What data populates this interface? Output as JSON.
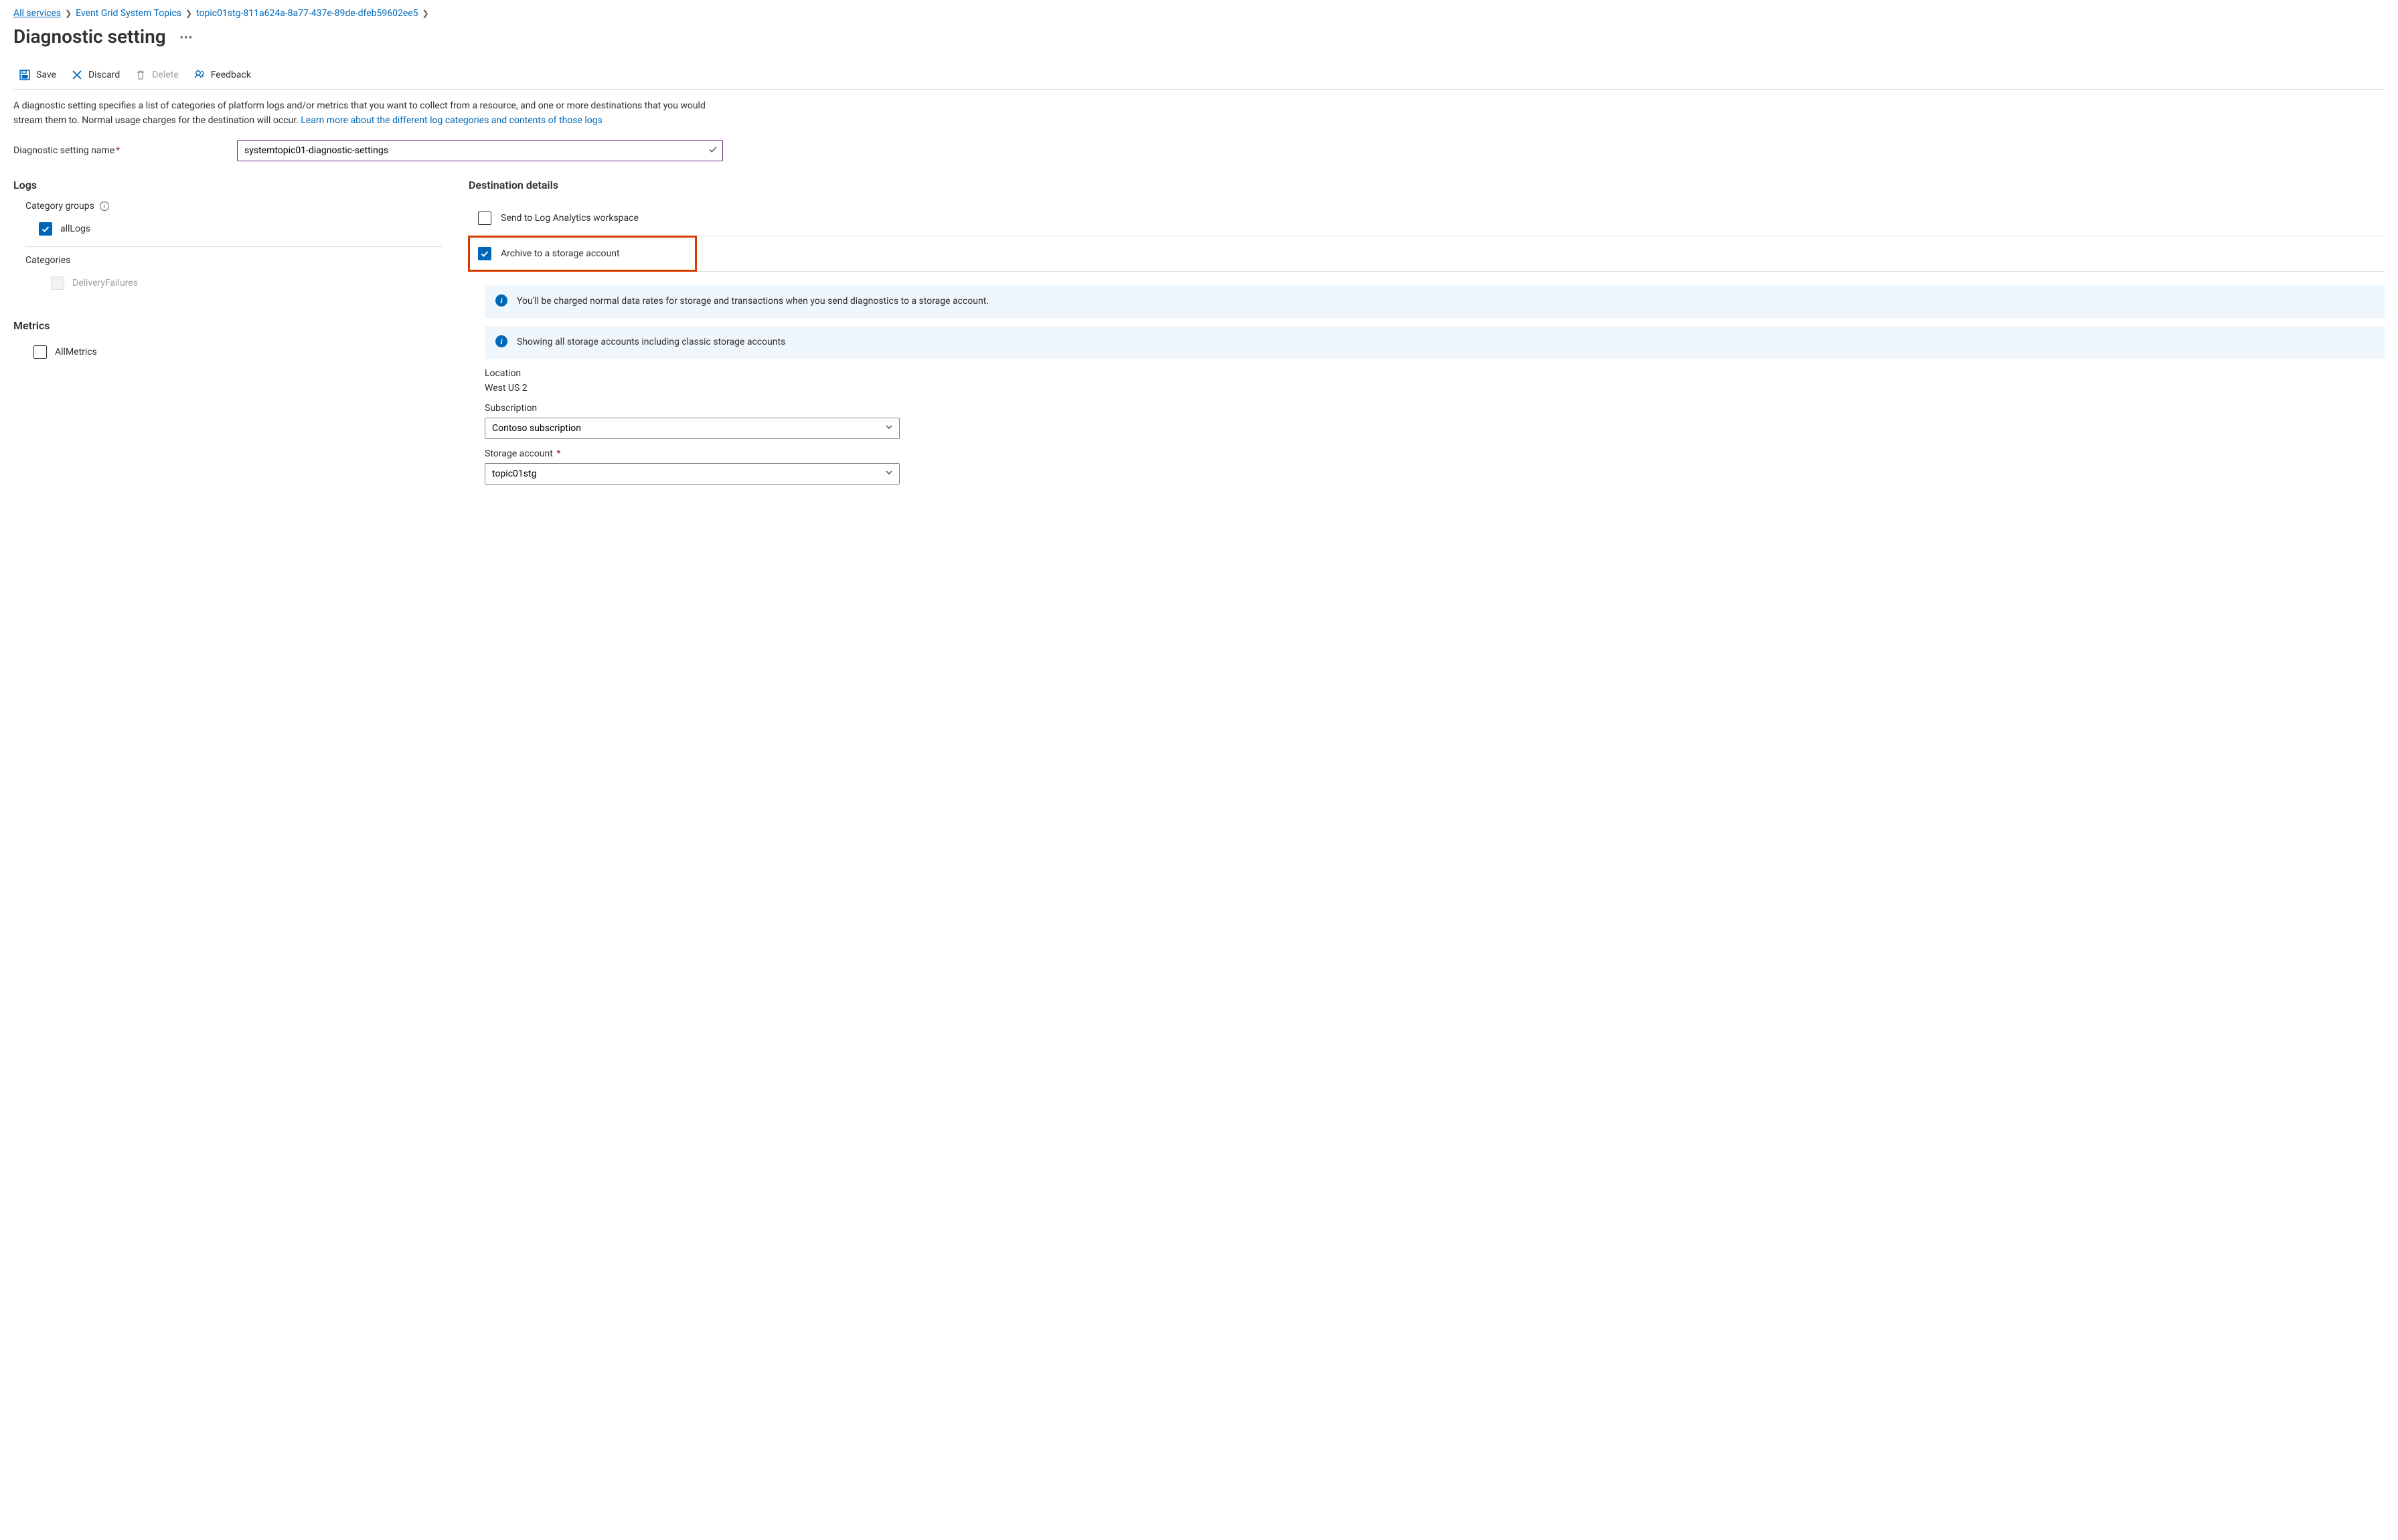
{
  "breadcrumbs": {
    "items": [
      "All services",
      "Event Grid System Topics",
      "topic01stg-811a624a-8a77-437e-89de-dfeb59602ee5"
    ]
  },
  "page": {
    "title": "Diagnostic setting"
  },
  "toolbar": {
    "save": "Save",
    "discard": "Discard",
    "delete": "Delete",
    "feedback": "Feedback"
  },
  "description": {
    "text": "A diagnostic setting specifies a list of categories of platform logs and/or metrics that you want to collect from a resource, and one or more destinations that you would stream them to. Normal usage charges for the destination will occur. ",
    "link": "Learn more about the different log categories and contents of those logs"
  },
  "form": {
    "name_label": "Diagnostic setting name",
    "name_value": "systemtopic01-diagnostic-settings"
  },
  "logs": {
    "heading": "Logs",
    "category_groups_label": "Category groups",
    "allLogs": {
      "label": "allLogs",
      "checked": true
    },
    "categories_label": "Categories",
    "deliveryFailures": {
      "label": "DeliveryFailures",
      "checked": false,
      "disabled": true
    }
  },
  "metrics": {
    "heading": "Metrics",
    "allMetrics": {
      "label": "AllMetrics",
      "checked": false
    }
  },
  "destination": {
    "heading": "Destination details",
    "log_analytics": {
      "label": "Send to Log Analytics workspace",
      "checked": false
    },
    "storage": {
      "label": "Archive to a storage account",
      "checked": true
    },
    "info1": "You'll be charged normal data rates for storage and transactions when you send diagnostics to a storage account.",
    "info2": "Showing all storage accounts including classic storage accounts",
    "location_label": "Location",
    "location_value": "West US 2",
    "subscription_label": "Subscription",
    "subscription_value": "Contoso subscription",
    "storage_account_label": "Storage account",
    "storage_account_value": "topic01stg"
  }
}
